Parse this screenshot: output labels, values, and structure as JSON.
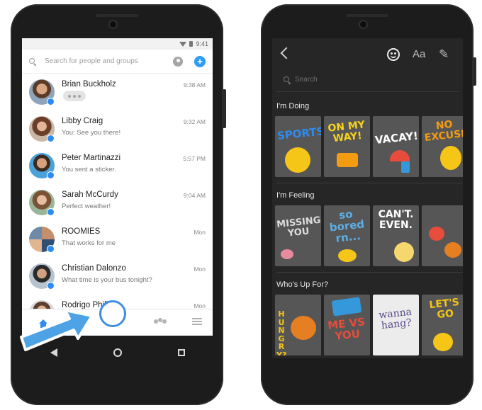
{
  "left_phone": {
    "status": {
      "time": "9:41"
    },
    "search": {
      "placeholder": "Search for people and groups"
    },
    "conversations": [
      {
        "name": "Brian Buckholz",
        "preview": "",
        "typing": true,
        "time": "9:38 AM"
      },
      {
        "name": "Libby Craig",
        "preview": "You: See you there!",
        "typing": false,
        "time": "9:32 AM"
      },
      {
        "name": "Peter Martinazzi",
        "preview": "You sent a sticker.",
        "typing": false,
        "time": "5:57 PM"
      },
      {
        "name": "Sarah McCurdy",
        "preview": "Perfect weather!",
        "typing": false,
        "time": "9:04 AM"
      },
      {
        "name": "ROOMIES",
        "preview": "That works for me",
        "typing": false,
        "time": "Mon"
      },
      {
        "name": "Christian Dalonzo",
        "preview": "What time is your bus tonight?",
        "typing": false,
        "time": "Mon"
      },
      {
        "name": "Rodrigo Phill...",
        "preview": "",
        "typing": false,
        "time": "Mon"
      }
    ],
    "tabs": [
      "home-icon",
      "groups-icon",
      "menu-icon"
    ],
    "accent": "#2d8cf0"
  },
  "right_phone": {
    "toolbar": {
      "text_icon_label": "Aa"
    },
    "search": {
      "placeholder": "Search"
    },
    "sections": [
      {
        "title": "I'm Doing",
        "stickers": [
          "SPORTS!",
          "ON MY WAY!",
          "VACAY!",
          "NO EXCUSES"
        ]
      },
      {
        "title": "I'm Feeling",
        "stickers": [
          "MISSING YOU",
          "so bored rn...",
          "CAN'T. EVEN.",
          ""
        ]
      },
      {
        "title": "Who's Up For?",
        "stickers": [
          "HUNGRY?",
          "ME VS YOU",
          "wanna hang?",
          "LET'S GO"
        ]
      }
    ]
  }
}
